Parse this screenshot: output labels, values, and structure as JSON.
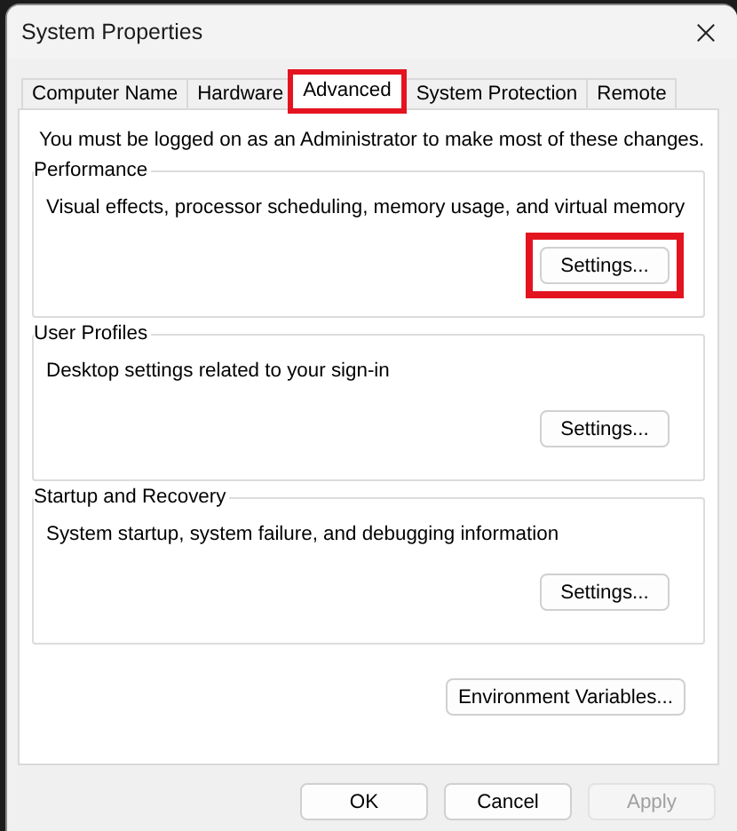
{
  "window": {
    "title": "System Properties"
  },
  "tabs": [
    {
      "label": "Computer Name",
      "selected": false,
      "highlighted": false
    },
    {
      "label": "Hardware",
      "selected": false,
      "highlighted": false
    },
    {
      "label": "Advanced",
      "selected": true,
      "highlighted": true
    },
    {
      "label": "System Protection",
      "selected": false,
      "highlighted": false
    },
    {
      "label": "Remote",
      "selected": false,
      "highlighted": false
    }
  ],
  "notice": "You must be logged on as an Administrator to make most of these changes.",
  "groups": [
    {
      "title": "Performance",
      "description": "Visual effects, processor scheduling, memory usage, and virtual memory",
      "button": {
        "label": "Settings...",
        "highlighted": true
      }
    },
    {
      "title": "User Profiles",
      "description": "Desktop settings related to your sign-in",
      "button": {
        "label": "Settings...",
        "highlighted": false
      }
    },
    {
      "title": "Startup and Recovery",
      "description": "System startup, system failure, and debugging information",
      "button": {
        "label": "Settings...",
        "highlighted": false
      }
    }
  ],
  "environment_button": {
    "label": "Environment Variables..."
  },
  "footer_buttons": [
    {
      "label": "OK",
      "disabled": false
    },
    {
      "label": "Cancel",
      "disabled": false
    },
    {
      "label": "Apply",
      "disabled": true
    }
  ]
}
